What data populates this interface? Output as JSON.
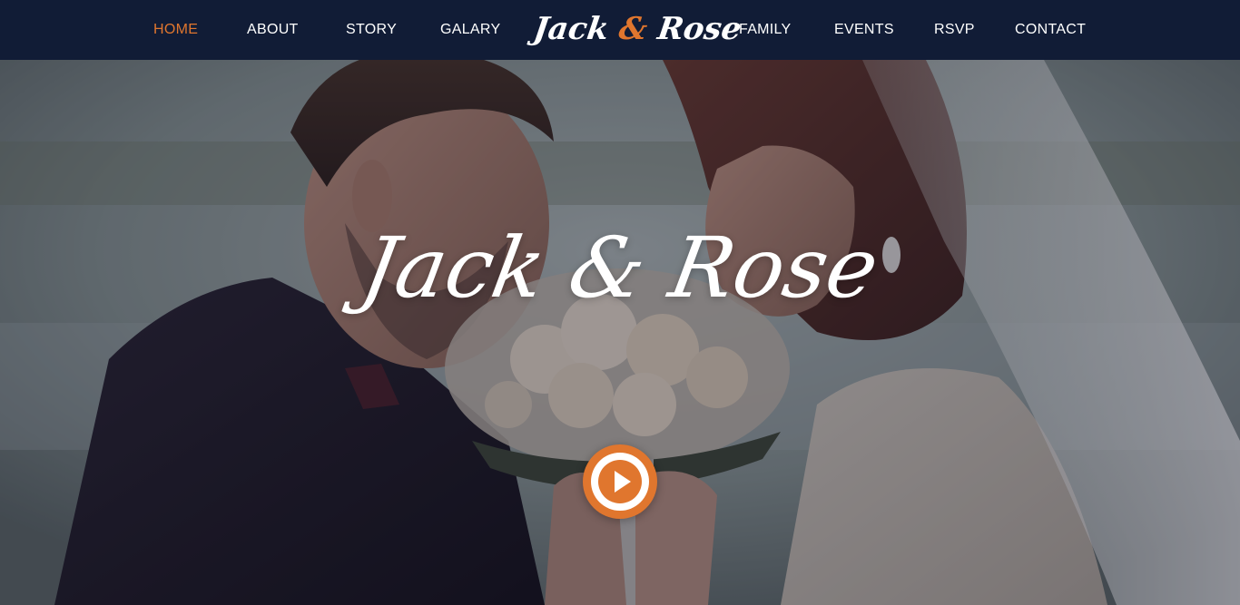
{
  "nav": {
    "left": [
      {
        "label": "HOME",
        "active": true
      },
      {
        "label": "ABOUT",
        "active": false
      },
      {
        "label": "STORY",
        "active": false
      },
      {
        "label": "GALARY",
        "active": false
      }
    ],
    "brand": {
      "first": "Jack ",
      "amp": "&",
      "second": " Rose"
    },
    "right": [
      {
        "label": "FAMILY",
        "active": false
      },
      {
        "label": "EVENTS",
        "active": false
      },
      {
        "label": "RSVP",
        "active": false
      },
      {
        "label": "CONTACT",
        "active": false
      }
    ]
  },
  "hero": {
    "title": "Jack & Rose",
    "image": "couple-with-bouquet-photo",
    "play_icon": "play-icon"
  },
  "colors": {
    "navbar_bg": "#111c36",
    "accent": "#e0762e",
    "text": "#ffffff"
  }
}
